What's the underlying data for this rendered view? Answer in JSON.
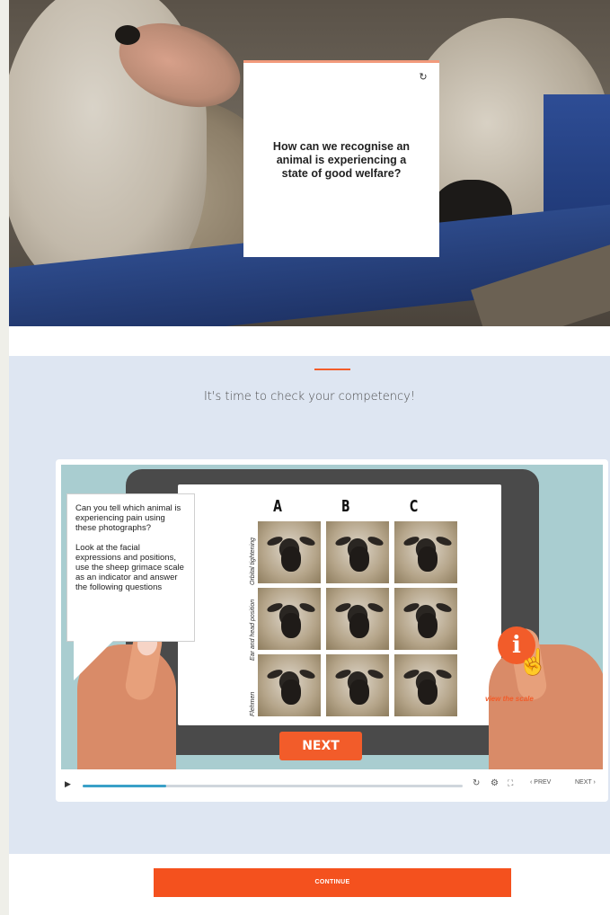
{
  "hero": {
    "card": {
      "question": "How can we recognise an animal is experiencing a state of good welfare?",
      "flip_icon": "rotate-icon"
    }
  },
  "section": {
    "heading": "It's time to check your competency!",
    "accent_color": "#f25c2a"
  },
  "player": {
    "speech_paragraphs": [
      "Can you tell which animal is experiencing pain using these photographs?",
      "Look at the facial expressions and positions, use the sheep grimace scale as an indicator and answer the following questions"
    ],
    "columns": [
      "A",
      "B",
      "C"
    ],
    "row_labels": [
      "Orbital tightening",
      "Ear and head position",
      "Flehmen"
    ],
    "info_icon_label": "i",
    "view_scale": "view the scale",
    "next_label": "NEXT",
    "controls": {
      "progress": 0.22,
      "prev": "‹ PREV",
      "next": "NEXT ›"
    }
  },
  "continue_label": "CONTINUE"
}
